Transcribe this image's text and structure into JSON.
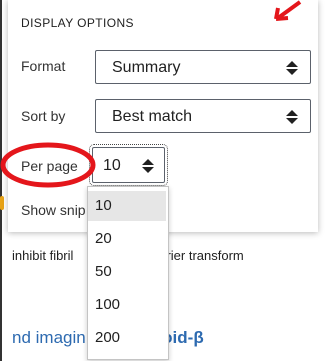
{
  "panel": {
    "title": "DISPLAY OPTIONS",
    "format": {
      "label": "Format",
      "value": "Summary"
    },
    "sort": {
      "label": "Sort by",
      "value": "Best match"
    },
    "per_page": {
      "label": "Per page",
      "value": "10"
    },
    "show_snippets": {
      "label": "Show snip"
    }
  },
  "dropdown": {
    "options": [
      "10",
      "20",
      "50",
      "100",
      "200"
    ],
    "selected": "10"
  },
  "background": {
    "line1_left": "inhibit fibril",
    "line1_right": "ourier transform",
    "link_left": "nd imagin",
    "link_right": "yloid-β"
  },
  "annotation": {
    "color": "#e4161b"
  }
}
